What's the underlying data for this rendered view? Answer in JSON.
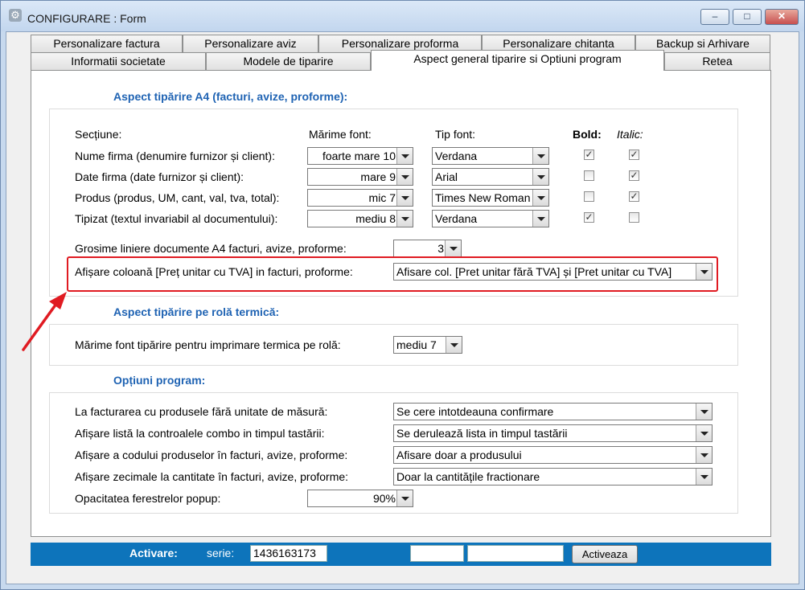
{
  "window": {
    "title": "CONFIGURARE : Form",
    "min": "–",
    "max": "□",
    "close": "✕",
    "icon": "gear-icon"
  },
  "tabs_row1": [
    "Personalizare factura",
    "Personalizare aviz",
    "Personalizare proforma",
    "Personalizare chitanta",
    "Backup si Arhivare"
  ],
  "tabs_row2": [
    "Informatii societate",
    "Modele de tiparire",
    "Aspect general tiparire si Optiuni program",
    "Retea"
  ],
  "a4": {
    "title": "Aspect tipărire A4 (facturi, avize, proforme):",
    "headers": {
      "section": "Secțiune:",
      "size": "Mărime font:",
      "type": "Tip font:",
      "bold": "Bold:",
      "italic": "Italic:"
    },
    "rows": [
      {
        "label": "Nume firma (denumire furnizor și client):",
        "size": "foarte mare 10",
        "font": "Verdana",
        "bold": true,
        "italic": true
      },
      {
        "label": "Date firma (date furnizor și client):",
        "size": "mare 9",
        "font": "Arial",
        "bold": false,
        "italic": true
      },
      {
        "label": "Produs (produs, UM, cant, val, tva, total):",
        "size": "mic 7",
        "font": "Times New Roman",
        "bold": false,
        "italic": true
      },
      {
        "label": "Tipizat (textul invariabil al documentului):",
        "size": "mediu 8",
        "font": "Verdana",
        "bold": true,
        "italic": false
      }
    ],
    "thickness_label": "Grosime liniere documente A4 facturi, avize, proforme:",
    "thickness_value": "3",
    "col_label": "Afișare coloană [Preț unitar cu TVA] in facturi, proforme:",
    "col_value": "Afisare col. [Pret unitar fără TVA] și [Pret unitar cu TVA]"
  },
  "roll": {
    "title": "Aspect tipărire pe rolă termică:",
    "font_label": "Mărime font tipărire pentru imprimare termica pe rolă:",
    "font_value": "mediu 7"
  },
  "options": {
    "title": "Opțiuni program:",
    "rows": [
      {
        "label": "La facturarea cu produsele fără unitate de măsură:",
        "value": "Se cere intotdeauna confirmare"
      },
      {
        "label": "Afișare listă la controalele combo in timpul tastării:",
        "value": "Se derulează lista in timpul tastării"
      },
      {
        "label": "Afișare a codului produselor în facturi, avize, proforme:",
        "value": "Afisare doar a produsului"
      },
      {
        "label": "Afișare zecimale la cantitate în facturi, avize, proforme:",
        "value": "Doar la cantitățile fractionare"
      }
    ],
    "opacity_label": "Opacitatea ferestrelor popup:",
    "opacity_value": "90%"
  },
  "activation": {
    "label": "Activare:",
    "serie_label": "serie:",
    "serie_value": "1436163173",
    "field2": "",
    "field3": "",
    "button": "Activeaza"
  },
  "colors": {
    "accent": "#1f63b3",
    "activation_bar": "#0d74bb",
    "highlight": "#e01b22"
  }
}
